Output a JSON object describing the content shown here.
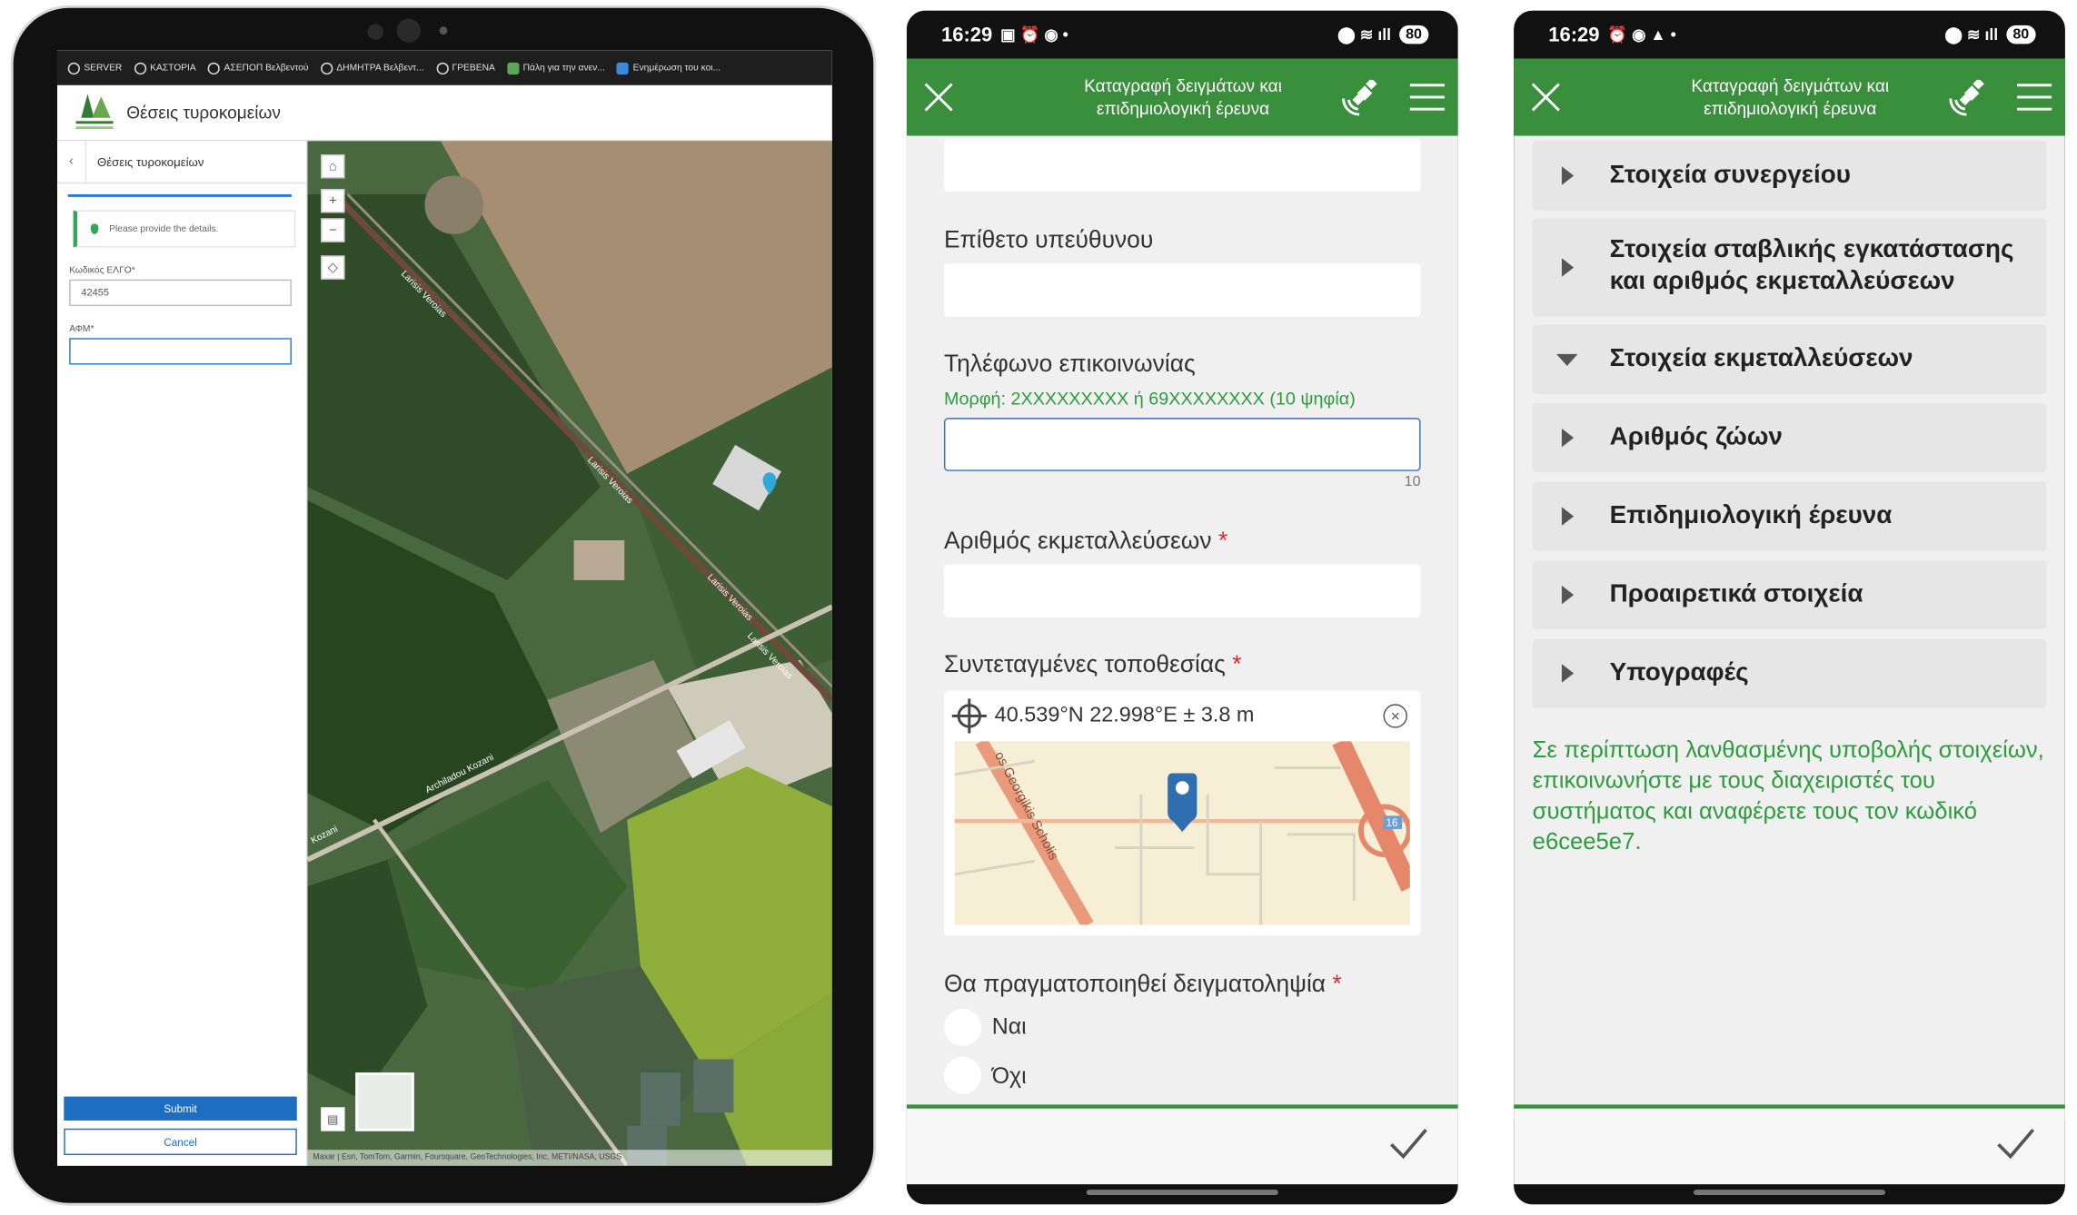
{
  "tablet": {
    "bookmarks": [
      "SERVER",
      "ΚΑΣΤΟΡΙΑ",
      "ΑΣΕΠΟΠ Βελβεντού",
      "ΔΗΜΗΤΡΑ Βελβεντ...",
      "ΓΡΕΒΕΝΑ",
      "Πάλη για την ανεν...",
      "Ενημέρωση του κοι..."
    ],
    "app_title": "Θέσεις τυροκομείων",
    "panel_title": "Θέσεις τυροκομείων",
    "notice": "Please provide the details.",
    "field1_label": "Κωδικός ΕΛΓΟ*",
    "field1_value": "42455",
    "field2_label": "ΑΦΜ*",
    "field2_value": "",
    "submit": "Submit",
    "cancel": "Cancel",
    "map_road_labels": [
      "Larisis Veroias",
      "Larisis Veroias",
      "Larisis Veroias",
      "Larisis Veroias",
      "Archiladou Kozani",
      "Kozani"
    ],
    "attribution": "Maxar | Esri, TomTom, Garmin, Foursquare, GeoTechnologies, Inc, METI/NASA, USGS"
  },
  "phone1": {
    "time": "16:29",
    "battery": "80",
    "title": "Καταγραφή δειγμάτων και επιδημιολογική έρευνα",
    "q_surname": "Επίθετο υπεύθυνου",
    "q_phone": "Τηλέφωνο επικοινωνίας",
    "phone_hint": "Μορφή: 2XXXXXXXXX ή 69XXXXXXXX (10 ψηφία)",
    "phone_counter": "10",
    "q_farms": "Αριθμός εκμεταλλεύσεων",
    "q_coords": "Συντεταγμένες τοποθεσίας",
    "coords_value": "40.539°N 22.998°E ± 3.8 m",
    "map_street": "os Georgikis Scholis",
    "map_route": "16",
    "q_sampling": "Θα πραγματοποιηθεί δειγματοληψία",
    "opt_yes": "Ναι",
    "opt_no": "Όχι",
    "required_mark": "*"
  },
  "phone2": {
    "time": "16:29",
    "battery": "80",
    "title": "Καταγραφή δειγμάτων και επιδημιολογική έρευνα",
    "sections": [
      {
        "label": "Στοιχεία συνεργείου",
        "expanded": false
      },
      {
        "label": "Στοιχεία σταβλικής εγκατάστασης και αριθμός εκμεταλλεύσεων",
        "expanded": false
      },
      {
        "label": "Στοιχεία εκμεταλλεύσεων",
        "expanded": true
      },
      {
        "label": "Αριθμός ζώων",
        "expanded": false
      },
      {
        "label": "Επιδημιολογική έρευνα",
        "expanded": false
      },
      {
        "label": "Προαιρετικά στοιχεία",
        "expanded": false
      },
      {
        "label": "Υπογραφές",
        "expanded": false
      }
    ],
    "note": "Σε περίπτωση λανθασμένης υποβολής στοιχείων, επικοινωνήστε με τους διαχειριστές του συστήματος και αναφέρετε τους τον κωδικό e6cee5e7."
  },
  "colors": {
    "brand_green": "#3a8f3c",
    "hint_green": "#2e9b3e",
    "submit_blue": "#1b6ec2",
    "required_red": "#d32f2f"
  },
  "icons": [
    "close-icon",
    "gps-satellite-icon",
    "hamburger-menu-icon",
    "check-icon",
    "crosshair-icon",
    "clear-icon",
    "map-pin-icon",
    "caret-right-icon",
    "caret-down-icon"
  ]
}
